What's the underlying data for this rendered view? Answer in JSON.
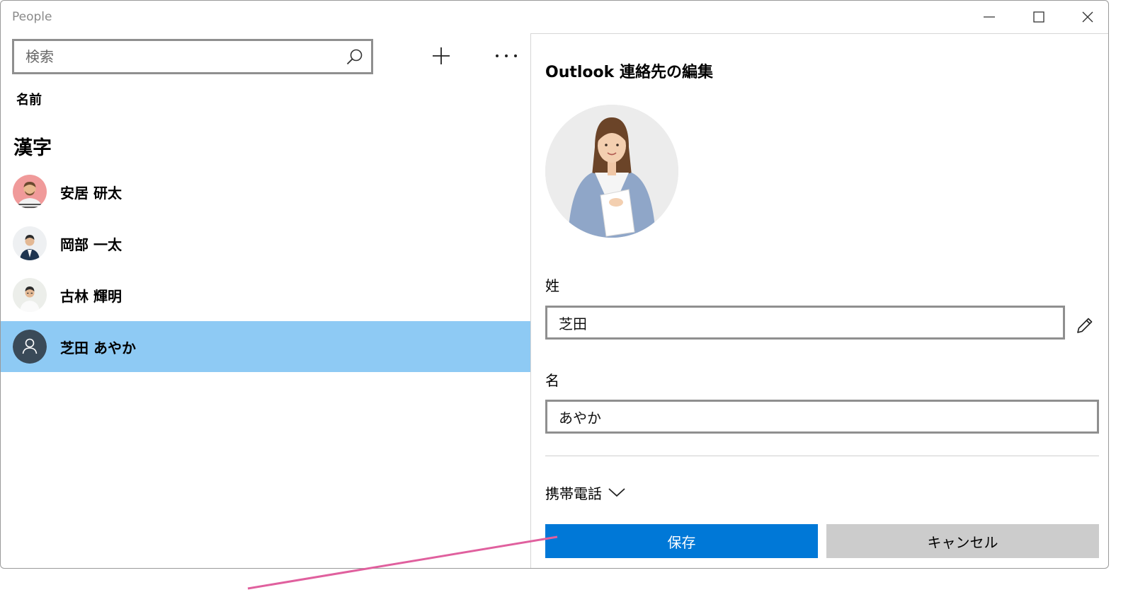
{
  "app": {
    "title": "People"
  },
  "left_pane": {
    "search": {
      "placeholder": "検索"
    },
    "sort_label": "名前",
    "group_header": "漢字",
    "contacts": [
      {
        "name": "安居 研太",
        "selected": false
      },
      {
        "name": "岡部 一太",
        "selected": false
      },
      {
        "name": "古林 輝明",
        "selected": false
      },
      {
        "name": "芝田 あやか",
        "selected": true
      }
    ]
  },
  "edit_pane": {
    "title": "Outlook 連絡先の編集",
    "last_name": {
      "label": "姓",
      "value": "芝田"
    },
    "first_name": {
      "label": "名",
      "value": "あやか"
    },
    "phone_toggle_label": "携帯電話",
    "save_label": "保存",
    "cancel_label": "キャンセル"
  },
  "colors": {
    "accent": "#0078d7",
    "selection": "#8ecaf4",
    "annotation_line": "#e0609e",
    "cancel_button": "#cccccc"
  },
  "icons": {
    "search": "search-icon",
    "add": "plus-icon",
    "more": "more-icon",
    "edit": "pencil-icon",
    "expand": "chevron-down-icon",
    "placeholder_avatar": "person-icon"
  }
}
